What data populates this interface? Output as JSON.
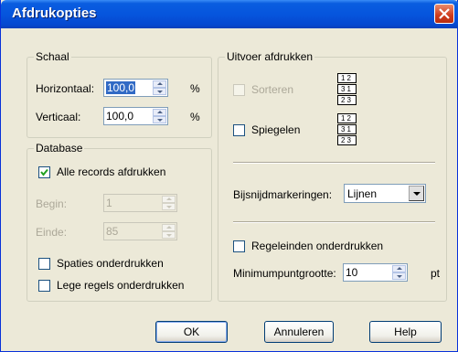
{
  "window": {
    "title": "Afdrukopties"
  },
  "schaal": {
    "legend": "Schaal",
    "horizontal": {
      "label": "Horizontaal:",
      "value": "100,0",
      "unit": "%"
    },
    "vertical": {
      "label": "Verticaal:",
      "value": "100,0",
      "unit": "%"
    }
  },
  "database": {
    "legend": "Database",
    "all_records": {
      "label": "Alle records afdrukken",
      "checked": true
    },
    "begin": {
      "label": "Begin:",
      "value": "1"
    },
    "end": {
      "label": "Einde:",
      "value": "85"
    },
    "suppress_spaces": {
      "label": "Spaties onderdrukken",
      "checked": false
    },
    "suppress_blank_lines": {
      "label": "Lege regels onderdrukken",
      "checked": false
    }
  },
  "output": {
    "legend": "Uitvoer afdrukken",
    "sort": {
      "label": "Sorteren",
      "checked": false,
      "enabled": false
    },
    "mirror": {
      "label": "Spiegelen",
      "checked": false
    },
    "collate_rows": [
      "12",
      "31",
      "23"
    ],
    "crop_marks": {
      "label": "Bijsnijdmarkeringen:",
      "value": "Lijnen"
    },
    "suppress_line_endings": {
      "label": "Regeleinden onderdrukken",
      "checked": false
    },
    "min_point_size": {
      "label": "Minimumpuntgrootte:",
      "value": "10",
      "unit": "pt"
    }
  },
  "buttons": {
    "ok": "OK",
    "cancel": "Annuleren",
    "help": "Help"
  }
}
